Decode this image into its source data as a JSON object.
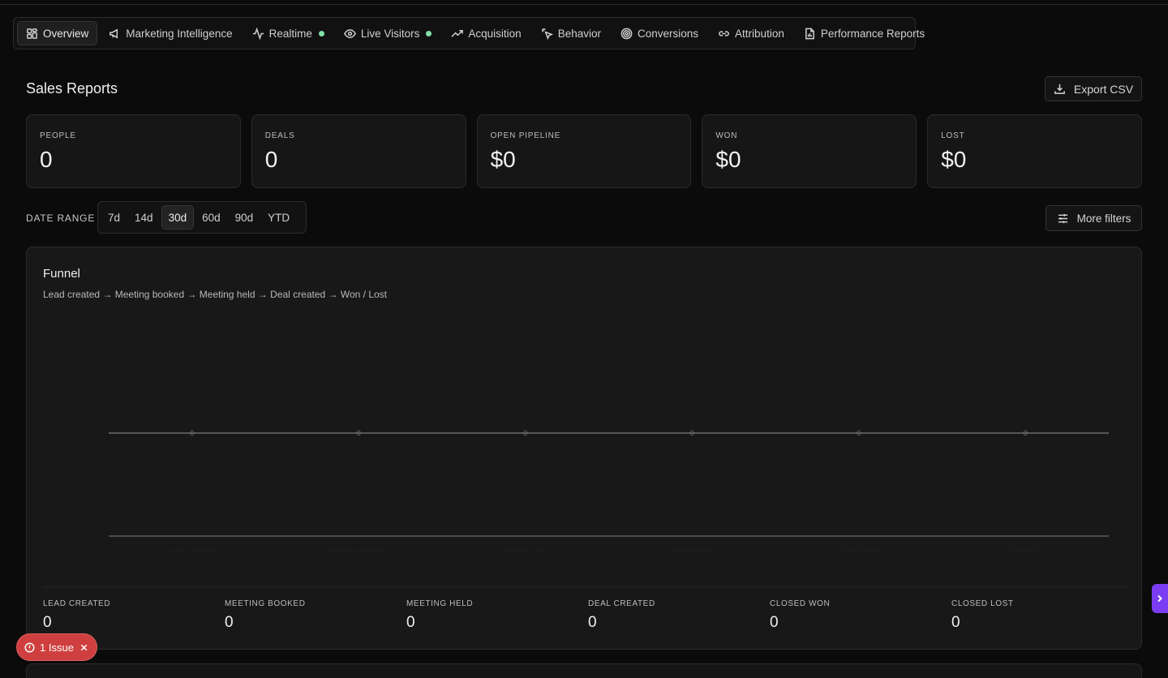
{
  "nav": {
    "items": [
      {
        "label": "Overview",
        "icon": "grid-icon",
        "active": true,
        "live": false
      },
      {
        "label": "Marketing Intelligence",
        "icon": "megaphone-icon",
        "active": false,
        "live": false
      },
      {
        "label": "Realtime",
        "icon": "activity-icon",
        "active": false,
        "live": true
      },
      {
        "label": "Live Visitors",
        "icon": "eye-icon",
        "active": false,
        "live": true
      },
      {
        "label": "Acquisition",
        "icon": "trending-up-icon",
        "active": false,
        "live": false
      },
      {
        "label": "Behavior",
        "icon": "pointer-click-icon",
        "active": false,
        "live": false
      },
      {
        "label": "Conversions",
        "icon": "target-icon",
        "active": false,
        "live": false
      },
      {
        "label": "Attribution",
        "icon": "link-icon",
        "active": false,
        "live": false
      },
      {
        "label": "Performance Reports",
        "icon": "file-report-icon",
        "active": false,
        "live": false
      }
    ],
    "live_dot_color": "#7fe0a8"
  },
  "header": {
    "title": "Sales Reports",
    "export_label": "Export CSV"
  },
  "stats": [
    {
      "label": "PEOPLE",
      "value": "0"
    },
    {
      "label": "DEALS",
      "value": "0"
    },
    {
      "label": "OPEN PIPELINE",
      "value": "$0"
    },
    {
      "label": "WON",
      "value": "$0"
    },
    {
      "label": "LOST",
      "value": "$0"
    }
  ],
  "date_range": {
    "label": "DATE RANGE",
    "options": [
      "7d",
      "14d",
      "30d",
      "60d",
      "90d",
      "YTD"
    ],
    "selected": "30d"
  },
  "filters": {
    "label": "More filters"
  },
  "funnel": {
    "title": "Funnel",
    "subtitle": "Lead created → Meeting booked → Meeting held → Deal created → Won / Lost",
    "stages": [
      {
        "label": "LEAD CREATED",
        "value": "0"
      },
      {
        "label": "MEETING BOOKED",
        "value": "0"
      },
      {
        "label": "MEETING HELD",
        "value": "0"
      },
      {
        "label": "DEAL CREATED",
        "value": "0"
      },
      {
        "label": "CLOSED WON",
        "value": "0"
      },
      {
        "label": "CLOSED LOST",
        "value": "0"
      }
    ]
  },
  "chart_data": {
    "type": "bar",
    "categories": [
      "Lead created",
      "Meeting booked",
      "Meeting held",
      "Deal created",
      "Closed won",
      "Closed lost"
    ],
    "values": [
      0,
      0,
      0,
      0,
      0,
      0
    ],
    "data_labels": [
      "0",
      "0",
      "0",
      "0",
      "0",
      "0"
    ],
    "title": "",
    "xlabel": "",
    "ylabel": "",
    "grid": true
  },
  "issue": {
    "label": "1 Issue",
    "color": "#cf3f3f"
  },
  "accent": "#7b3df2"
}
